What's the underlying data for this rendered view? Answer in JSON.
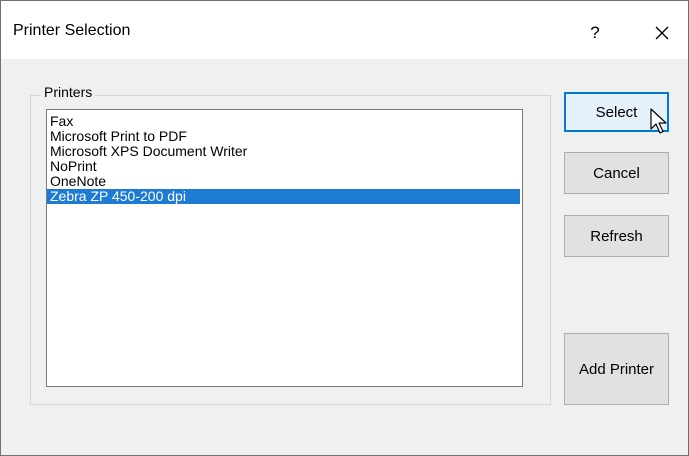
{
  "window": {
    "title": "Printer Selection",
    "help_glyph": "?",
    "close_icon": "close-icon"
  },
  "printers": {
    "group_label": "Printers",
    "items": [
      {
        "label": "Fax",
        "selected": false
      },
      {
        "label": "Microsoft Print to PDF",
        "selected": false
      },
      {
        "label": "Microsoft XPS Document Writer",
        "selected": false
      },
      {
        "label": "NoPrint",
        "selected": false
      },
      {
        "label": "OneNote",
        "selected": false
      },
      {
        "label": "Zebra  ZP 450-200 dpi",
        "selected": true
      }
    ]
  },
  "buttons": {
    "select": "Select",
    "cancel": "Cancel",
    "refresh": "Refresh",
    "add_printer": "Add Printer"
  },
  "colors": {
    "selection": "#1e7bd3",
    "default_button_border": "#0078d7"
  }
}
